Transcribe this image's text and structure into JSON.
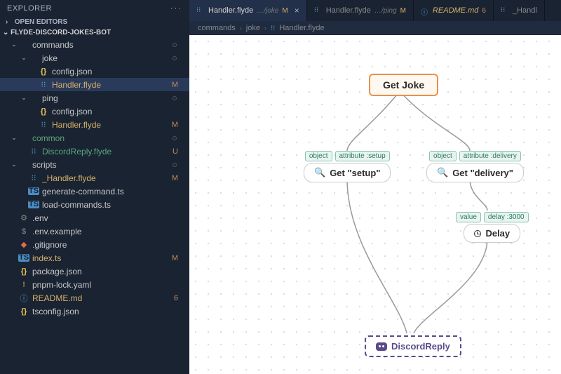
{
  "explorer": {
    "title": "EXPLORER",
    "sections": {
      "open_editors": "OPEN EDITORS",
      "project": "FLYDE-DISCORD-JOKES-BOT"
    }
  },
  "tree": [
    {
      "label": "commands",
      "type": "folder",
      "indent": 1,
      "dot": true
    },
    {
      "label": "joke",
      "type": "folder",
      "indent": 2,
      "dot": true
    },
    {
      "label": "config.json",
      "type": "json",
      "indent": 3
    },
    {
      "label": "Handler.flyde",
      "type": "flyde",
      "indent": 3,
      "badge": "M",
      "selected": true,
      "mod": true
    },
    {
      "label": "ping",
      "type": "folder",
      "indent": 2,
      "dot": true
    },
    {
      "label": "config.json",
      "type": "json",
      "indent": 3
    },
    {
      "label": "Handler.flyde",
      "type": "flyde",
      "indent": 3,
      "badge": "M",
      "mod": true
    },
    {
      "label": "common",
      "type": "folder",
      "indent": 1,
      "dot": true,
      "untracked": true
    },
    {
      "label": "DiscordReply.flyde",
      "type": "flyde",
      "indent": 2,
      "badge": "U",
      "untracked": true
    },
    {
      "label": "scripts",
      "type": "folder",
      "indent": 1,
      "dot": true
    },
    {
      "label": "_Handler.flyde",
      "type": "flyde",
      "indent": 2,
      "badge": "M",
      "mod": true
    },
    {
      "label": "generate-command.ts",
      "type": "ts",
      "indent": 2
    },
    {
      "label": "load-commands.ts",
      "type": "ts",
      "indent": 2
    },
    {
      "label": ".env",
      "type": "gear",
      "indent": 1
    },
    {
      "label": ".env.example",
      "type": "dollar",
      "indent": 1
    },
    {
      "label": ".gitignore",
      "type": "git",
      "indent": 1
    },
    {
      "label": "index.ts",
      "type": "ts",
      "indent": 1,
      "badge": "M",
      "mod": true
    },
    {
      "label": "package.json",
      "type": "json",
      "indent": 1
    },
    {
      "label": "pnpm-lock.yaml",
      "type": "pnpm",
      "indent": 1
    },
    {
      "label": "README.md",
      "type": "readme",
      "indent": 1,
      "badge": "6",
      "mod": true
    },
    {
      "label": "tsconfig.json",
      "type": "json",
      "indent": 1
    }
  ],
  "tabs": [
    {
      "name": "Handler.flyde",
      "sub": "…/joke",
      "m": "M",
      "active": true,
      "close": true,
      "icon": "flyde"
    },
    {
      "name": "Handler.flyde",
      "sub": "…/ping",
      "m": "M",
      "icon": "flyde"
    },
    {
      "name": "README.md",
      "num": "6",
      "readme": true
    },
    {
      "name": "_Handl",
      "icon": "flyde"
    }
  ],
  "breadcrumb": [
    "commands",
    "joke",
    "Handler.flyde"
  ],
  "nodes": {
    "root": {
      "label": "Get Joke"
    },
    "setup": {
      "pins": [
        "object",
        "attribute :setup"
      ],
      "label": "Get \"setup\""
    },
    "delivery": {
      "pins": [
        "object",
        "attribute :delivery"
      ],
      "label": "Get \"delivery\""
    },
    "delay": {
      "pins": [
        "value",
        "delay :3000"
      ],
      "label": "Delay"
    },
    "reply": {
      "label": "DiscordReply"
    }
  }
}
